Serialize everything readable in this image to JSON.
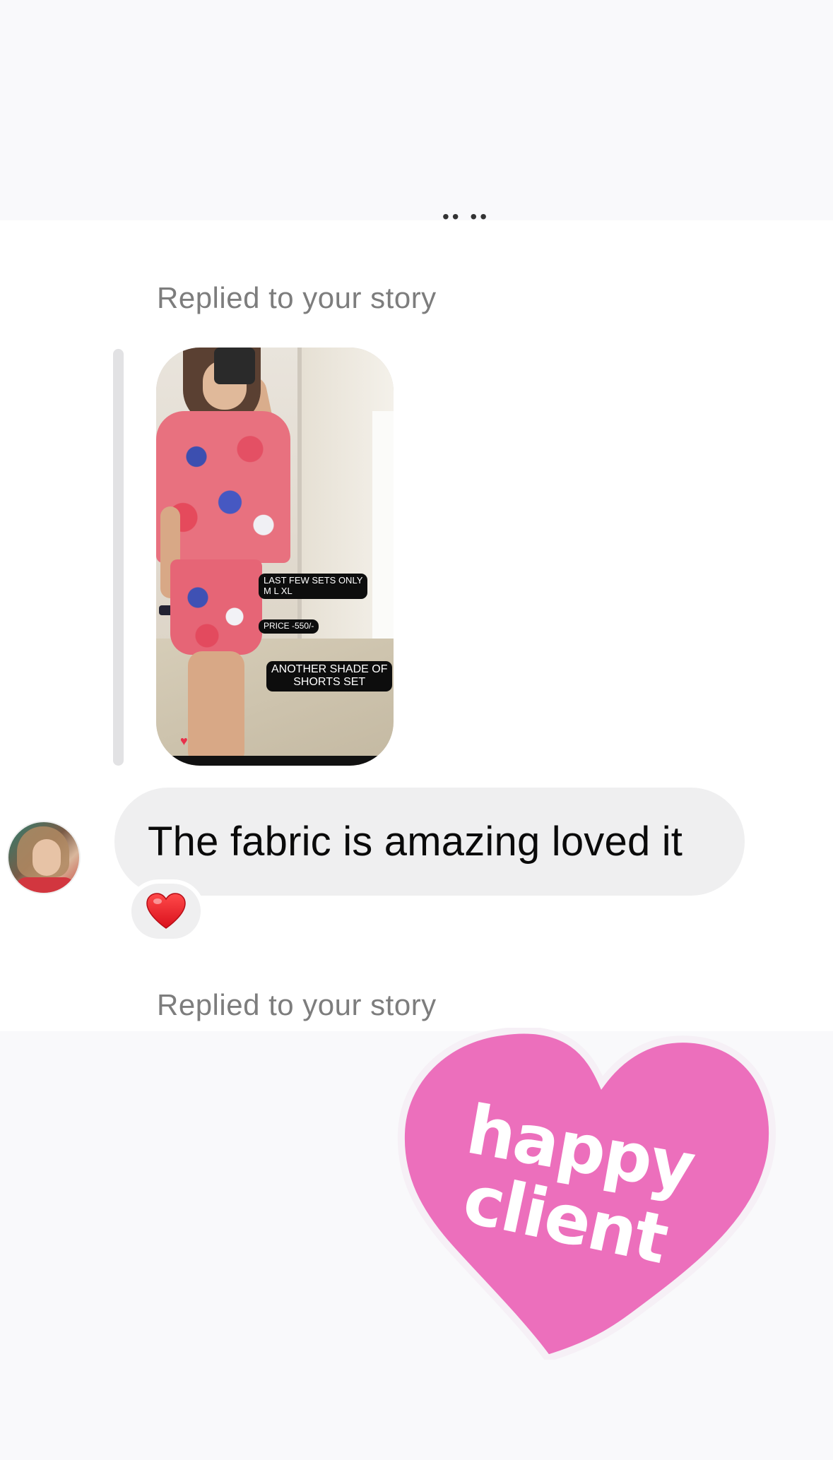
{
  "thread": {
    "messages": [
      {
        "reply_label": "Replied to your story",
        "story": {
          "stickers": [
            {
              "line1": "LAST FEW SETS ONLY",
              "line2": "M L XL"
            },
            {
              "line1": "PRICE -550/-",
              "line2": ""
            },
            {
              "line1": "ANOTHER SHADE OF",
              "line2": "SHORTS SET"
            }
          ]
        },
        "text": "The fabric is amazing loved it",
        "reaction": {
          "emoji": "❤️"
        }
      },
      {
        "reply_label": "Replied to your story",
        "story": {
          "sticker_text_line1": "happy",
          "sticker_text_line2": "client",
          "sticker_color": "#ec6fbc"
        }
      }
    ]
  },
  "colors": {
    "bubble_bg": "#efeff0",
    "label_gray": "#7d7d7d",
    "heart_pink": "#ec6fbc"
  }
}
